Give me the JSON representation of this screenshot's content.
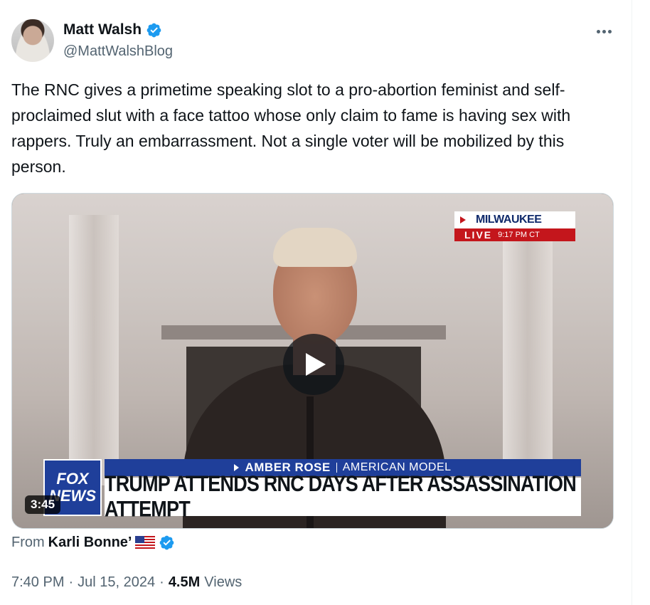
{
  "author": {
    "display_name": "Matt Walsh",
    "handle": "@MattWalshBlog",
    "verified": true
  },
  "tweet": {
    "text": "The RNC gives a primetime speaking slot to a pro-abortion feminist and self-proclaimed slut with a face tattoo whose only claim to fame is having sex with rappers. Truly an embarrassment. Not a single voter will be mobilized by this person."
  },
  "media": {
    "duration": "3:45",
    "location_city": "MILWAUKEE",
    "location_live": "LIVE",
    "location_time": "9:17 PM CT",
    "network_logo_line1": "FOX",
    "network_logo_line2": "NEWS",
    "chyron_name": "AMBER ROSE",
    "chyron_role": "AMERICAN MODEL",
    "chyron_headline": "TRUMP ATTENDS RNC DAYS AFTER ASSASSINATION ATTEMPT"
  },
  "source": {
    "prefix": "From",
    "name": "Karli Bonne’"
  },
  "meta": {
    "time": "7:40 PM",
    "separator": "·",
    "date": "Jul 15, 2024",
    "views_count": "4.5M",
    "views_label": "Views"
  },
  "colors": {
    "verified_blue": "#1d9bf0",
    "text_primary": "#0f1419",
    "text_secondary": "#536471",
    "fox_blue": "#1f3f9a",
    "fox_red": "#c4161c"
  },
  "icons": {
    "verified": "verified-badge-icon",
    "more": "more-options-icon",
    "play": "play-icon",
    "flag": "us-flag-icon"
  }
}
